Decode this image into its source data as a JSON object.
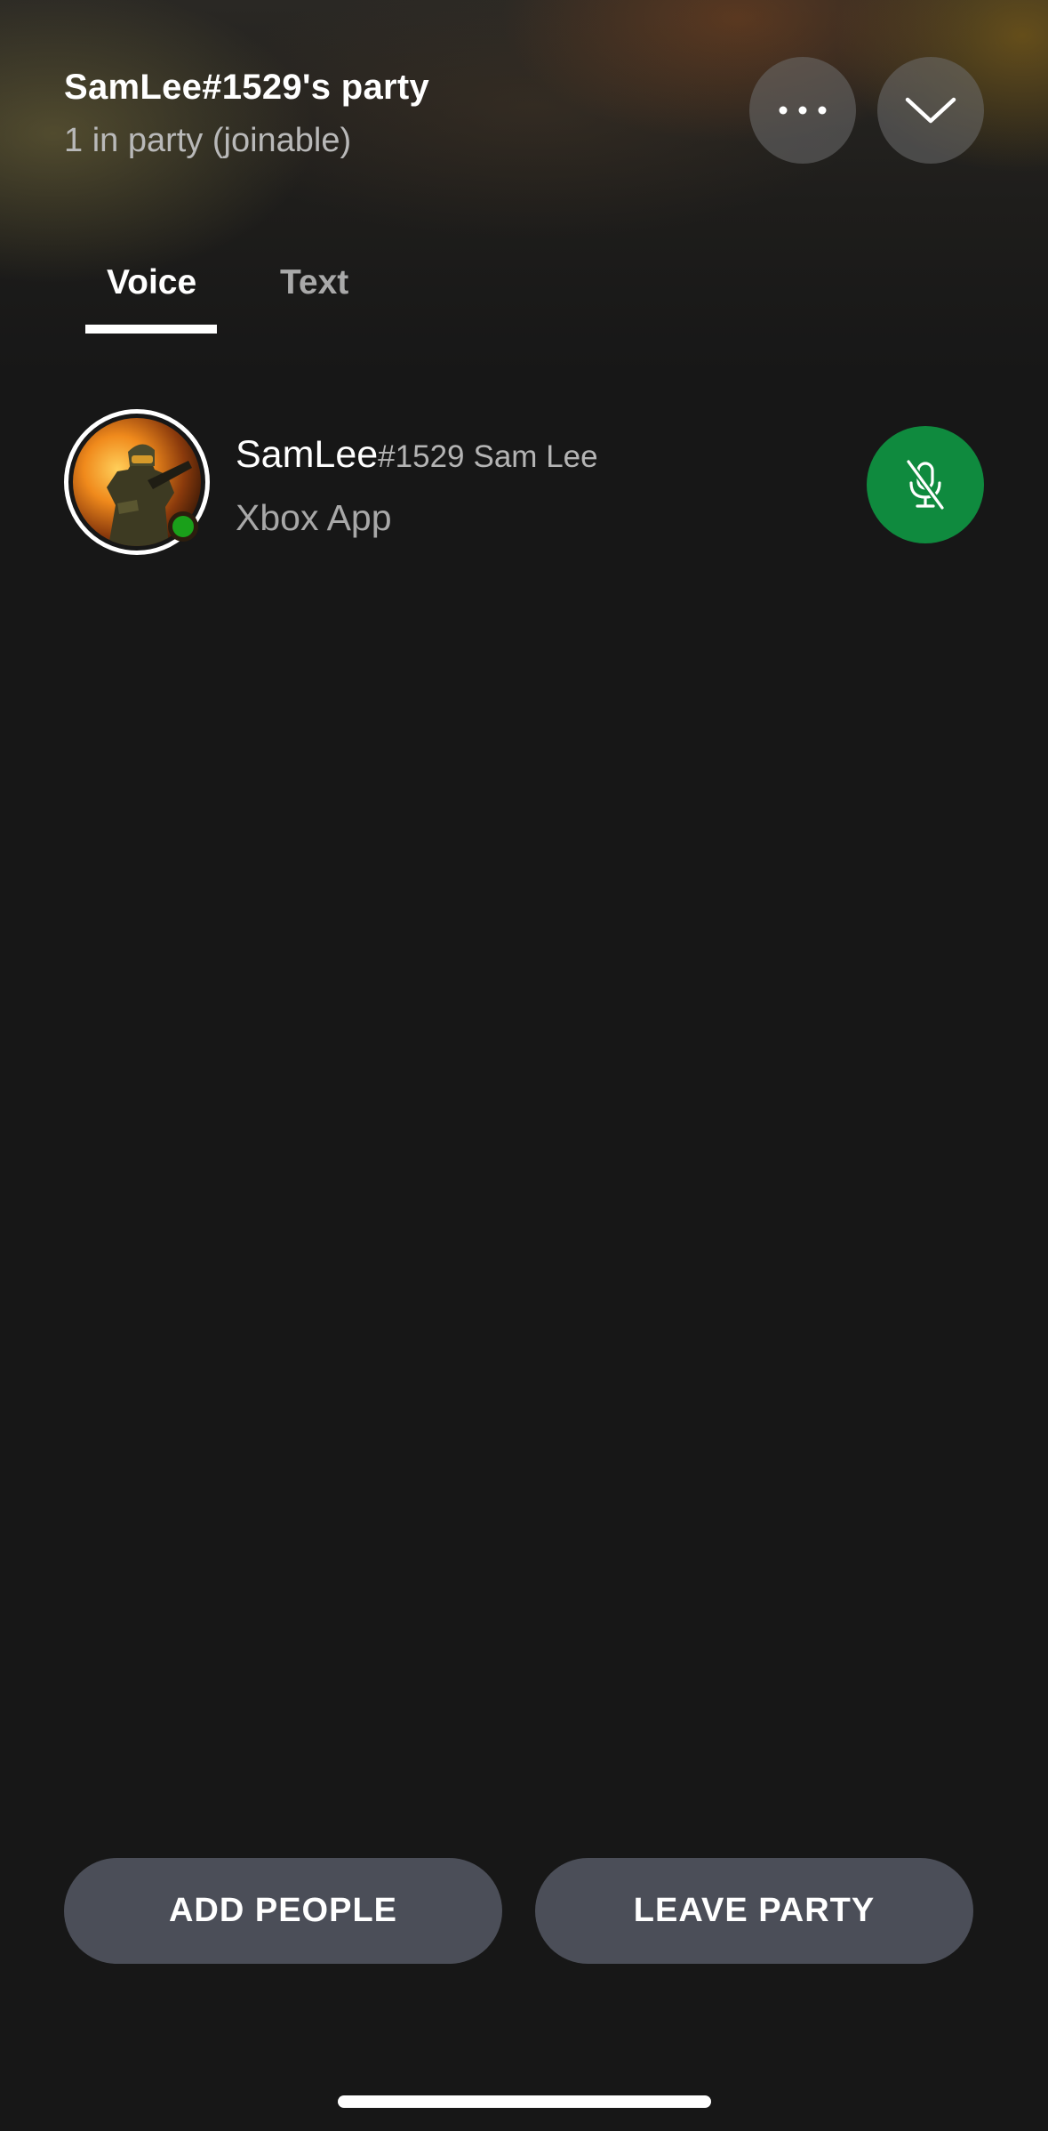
{
  "party": {
    "title": "SamLee#1529's party",
    "subtitle": "1 in party (joinable)"
  },
  "actions": {
    "more_icon": "more-horizontal-icon",
    "collapse_icon": "chevron-down-icon"
  },
  "tabs": [
    {
      "label": "Voice",
      "selected": true
    },
    {
      "label": "Text",
      "selected": false
    }
  ],
  "members": [
    {
      "gamertag": "SamLee",
      "suffix": "#1529",
      "real_name": "Sam Lee",
      "status": "Xbox App",
      "presence": "online",
      "mute_icon": "microphone-off-icon",
      "mute_button_color": "#0f8a3e"
    }
  ],
  "footer": {
    "add_people": "ADD PEOPLE",
    "leave_party": "LEAVE PARTY"
  },
  "colors": {
    "background": "#171717",
    "accent_green": "#0f8a3e",
    "presence_green": "#1aa01a",
    "pill_button": "#4b4e58"
  }
}
